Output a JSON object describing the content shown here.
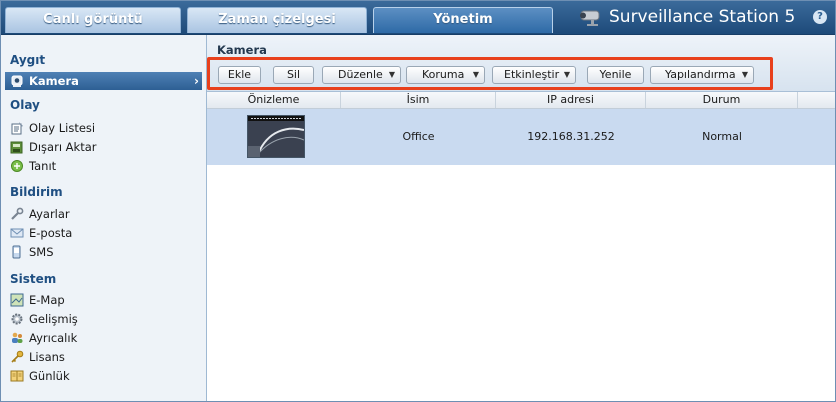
{
  "tabs": [
    {
      "label": "Canlı görüntü"
    },
    {
      "label": "Zaman çizelgesi"
    },
    {
      "label": "Yönetim"
    }
  ],
  "brand": {
    "title": "Surveillance Station 5",
    "help_icon": "?"
  },
  "sidebar": {
    "sections": [
      {
        "title": "Aygıt",
        "items": [
          {
            "label": "Kamera",
            "icon": "camera-icon",
            "active": true
          }
        ]
      },
      {
        "title": "Olay",
        "items": [
          {
            "label": "Olay Listesi",
            "icon": "event-list-icon"
          },
          {
            "label": "Dışarı Aktar",
            "icon": "export-icon"
          },
          {
            "label": "Tanıt",
            "icon": "introduce-icon"
          }
        ]
      },
      {
        "title": "Bildirim",
        "items": [
          {
            "label": "Ayarlar",
            "icon": "wrench-icon"
          },
          {
            "label": "E-posta",
            "icon": "email-icon"
          },
          {
            "label": "SMS",
            "icon": "sms-icon"
          }
        ]
      },
      {
        "title": "Sistem",
        "items": [
          {
            "label": "E-Map",
            "icon": "map-icon"
          },
          {
            "label": "Gelişmiş",
            "icon": "gear-icon"
          },
          {
            "label": "Ayrıcalık",
            "icon": "users-icon"
          },
          {
            "label": "Lisans",
            "icon": "key-icon"
          },
          {
            "label": "Günlük",
            "icon": "log-book-icon"
          }
        ]
      }
    ]
  },
  "panel": {
    "title": "Kamera",
    "toolbar": [
      {
        "label": "Ekle",
        "dropdown": false
      },
      {
        "label": "Sil",
        "dropdown": false
      },
      {
        "label": "Düzenle",
        "dropdown": true
      },
      {
        "label": "Koruma",
        "dropdown": true
      },
      {
        "label": "Etkinleştir",
        "dropdown": true
      },
      {
        "label": "Yenile",
        "dropdown": false
      },
      {
        "label": "Yapılandırma",
        "dropdown": true
      }
    ],
    "columns": [
      "Önizleme",
      "İsim",
      "IP adresi",
      "Durum"
    ],
    "rows": [
      {
        "name": "Office",
        "ip": "192.168.31.252",
        "status": "Normal"
      }
    ]
  },
  "colors": {
    "highlight": "#e8401c",
    "selected_row": "#c9daf0",
    "accent": "#2d5f94"
  }
}
